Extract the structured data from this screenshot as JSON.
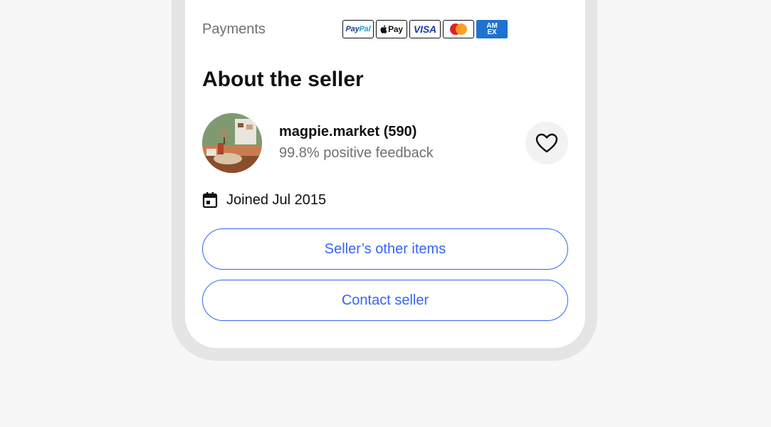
{
  "payments": {
    "label": "Payments",
    "methods": [
      {
        "name": "paypal-icon",
        "text_a": "Pay",
        "text_b": "Pal"
      },
      {
        "name": "apple-pay-icon",
        "text": "Pay"
      },
      {
        "name": "visa-icon",
        "text": "VISA"
      },
      {
        "name": "mastercard-icon"
      },
      {
        "name": "amex-icon",
        "text_a": "AM",
        "text_b": "EX"
      }
    ]
  },
  "about": {
    "title": "About the seller",
    "seller_name": "magpie.market (590)",
    "feedback": "99.8% positive feedback",
    "joined": "Joined Jul 2015"
  },
  "actions": {
    "other_items": "Seller’s other items",
    "contact": "Contact seller"
  },
  "colors": {
    "accent": "#3665f3",
    "text_primary": "#111111",
    "text_secondary": "#707070",
    "page_bg": "#f7f7f7"
  }
}
